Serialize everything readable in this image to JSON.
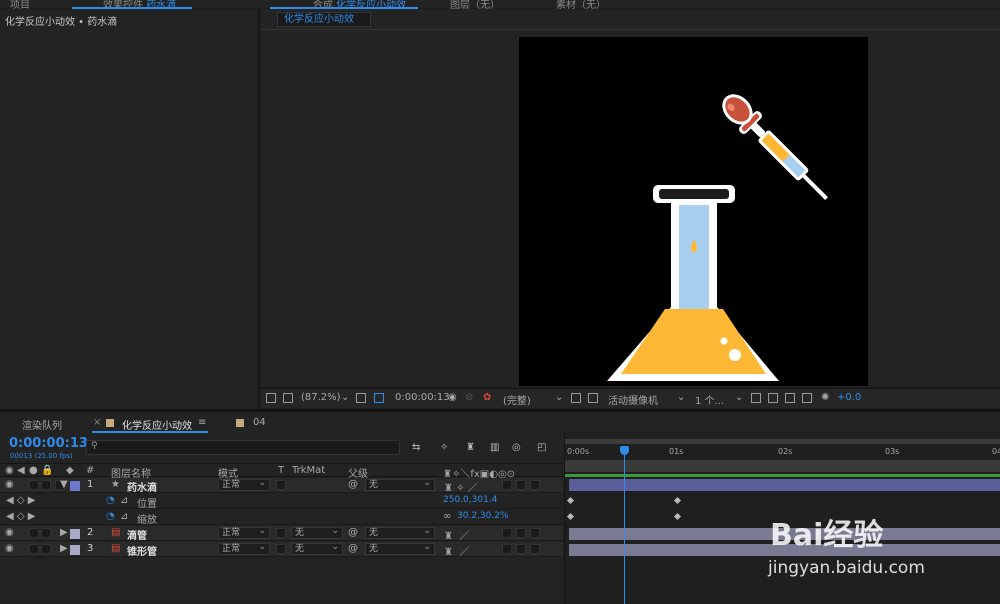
{
  "top_tabs": {
    "project": "项目",
    "effects_prefix": "效果控件",
    "effects_target": "药水滴",
    "comp_prefix": "合成",
    "comp_name": "化学反应小动效",
    "layer": "图层（无）",
    "footage": "素材（无）"
  },
  "effects_panel": {
    "title": "化学反应小动效 • 药水滴"
  },
  "viewer": {
    "comp_tab": "化学反应小动效",
    "zoom": "(87.2%)",
    "timecode": "0:00:00:13",
    "resolution": "(完整)",
    "camera": "活动摄像机",
    "views": "1 个...",
    "exposure": "+0.0"
  },
  "timeline": {
    "tabs": [
      "渲染队列",
      "化学反应小动效",
      "04"
    ],
    "timecode": "0:00:00:13",
    "fps": "00013 (25.00 fps)",
    "columns": {
      "num": "#",
      "name": "图层名称",
      "mode": "模式",
      "t": "T",
      "trkmat": "TrkMat",
      "parent": "父级"
    },
    "layers": [
      {
        "num": "1",
        "name": "药水滴",
        "mode": "正常",
        "trkmat": "",
        "parent": "无",
        "color": "#6b79cf"
      },
      {
        "num": "2",
        "name": "滴管",
        "mode": "正常",
        "trkmat": "无",
        "parent": "无",
        "color": "#a8a8c8"
      },
      {
        "num": "3",
        "name": "锥形管",
        "mode": "正常",
        "trkmat": "无",
        "parent": "无",
        "color": "#a8a8c8"
      }
    ],
    "properties": [
      {
        "name": "位置",
        "value": "250.0,301.4"
      },
      {
        "name": "缩放",
        "value": "30.2,30.2%"
      }
    ],
    "ruler": [
      "0:00s",
      "01s",
      "02s",
      "03s",
      "04"
    ]
  },
  "watermark": {
    "logo": "Bai经验",
    "url": "jingyan.baidu.com"
  },
  "colors": {
    "accent": "#2d8ceb",
    "liquid": "#ffb836",
    "glass": "#a8cff0",
    "bulb": "#c8513c"
  }
}
